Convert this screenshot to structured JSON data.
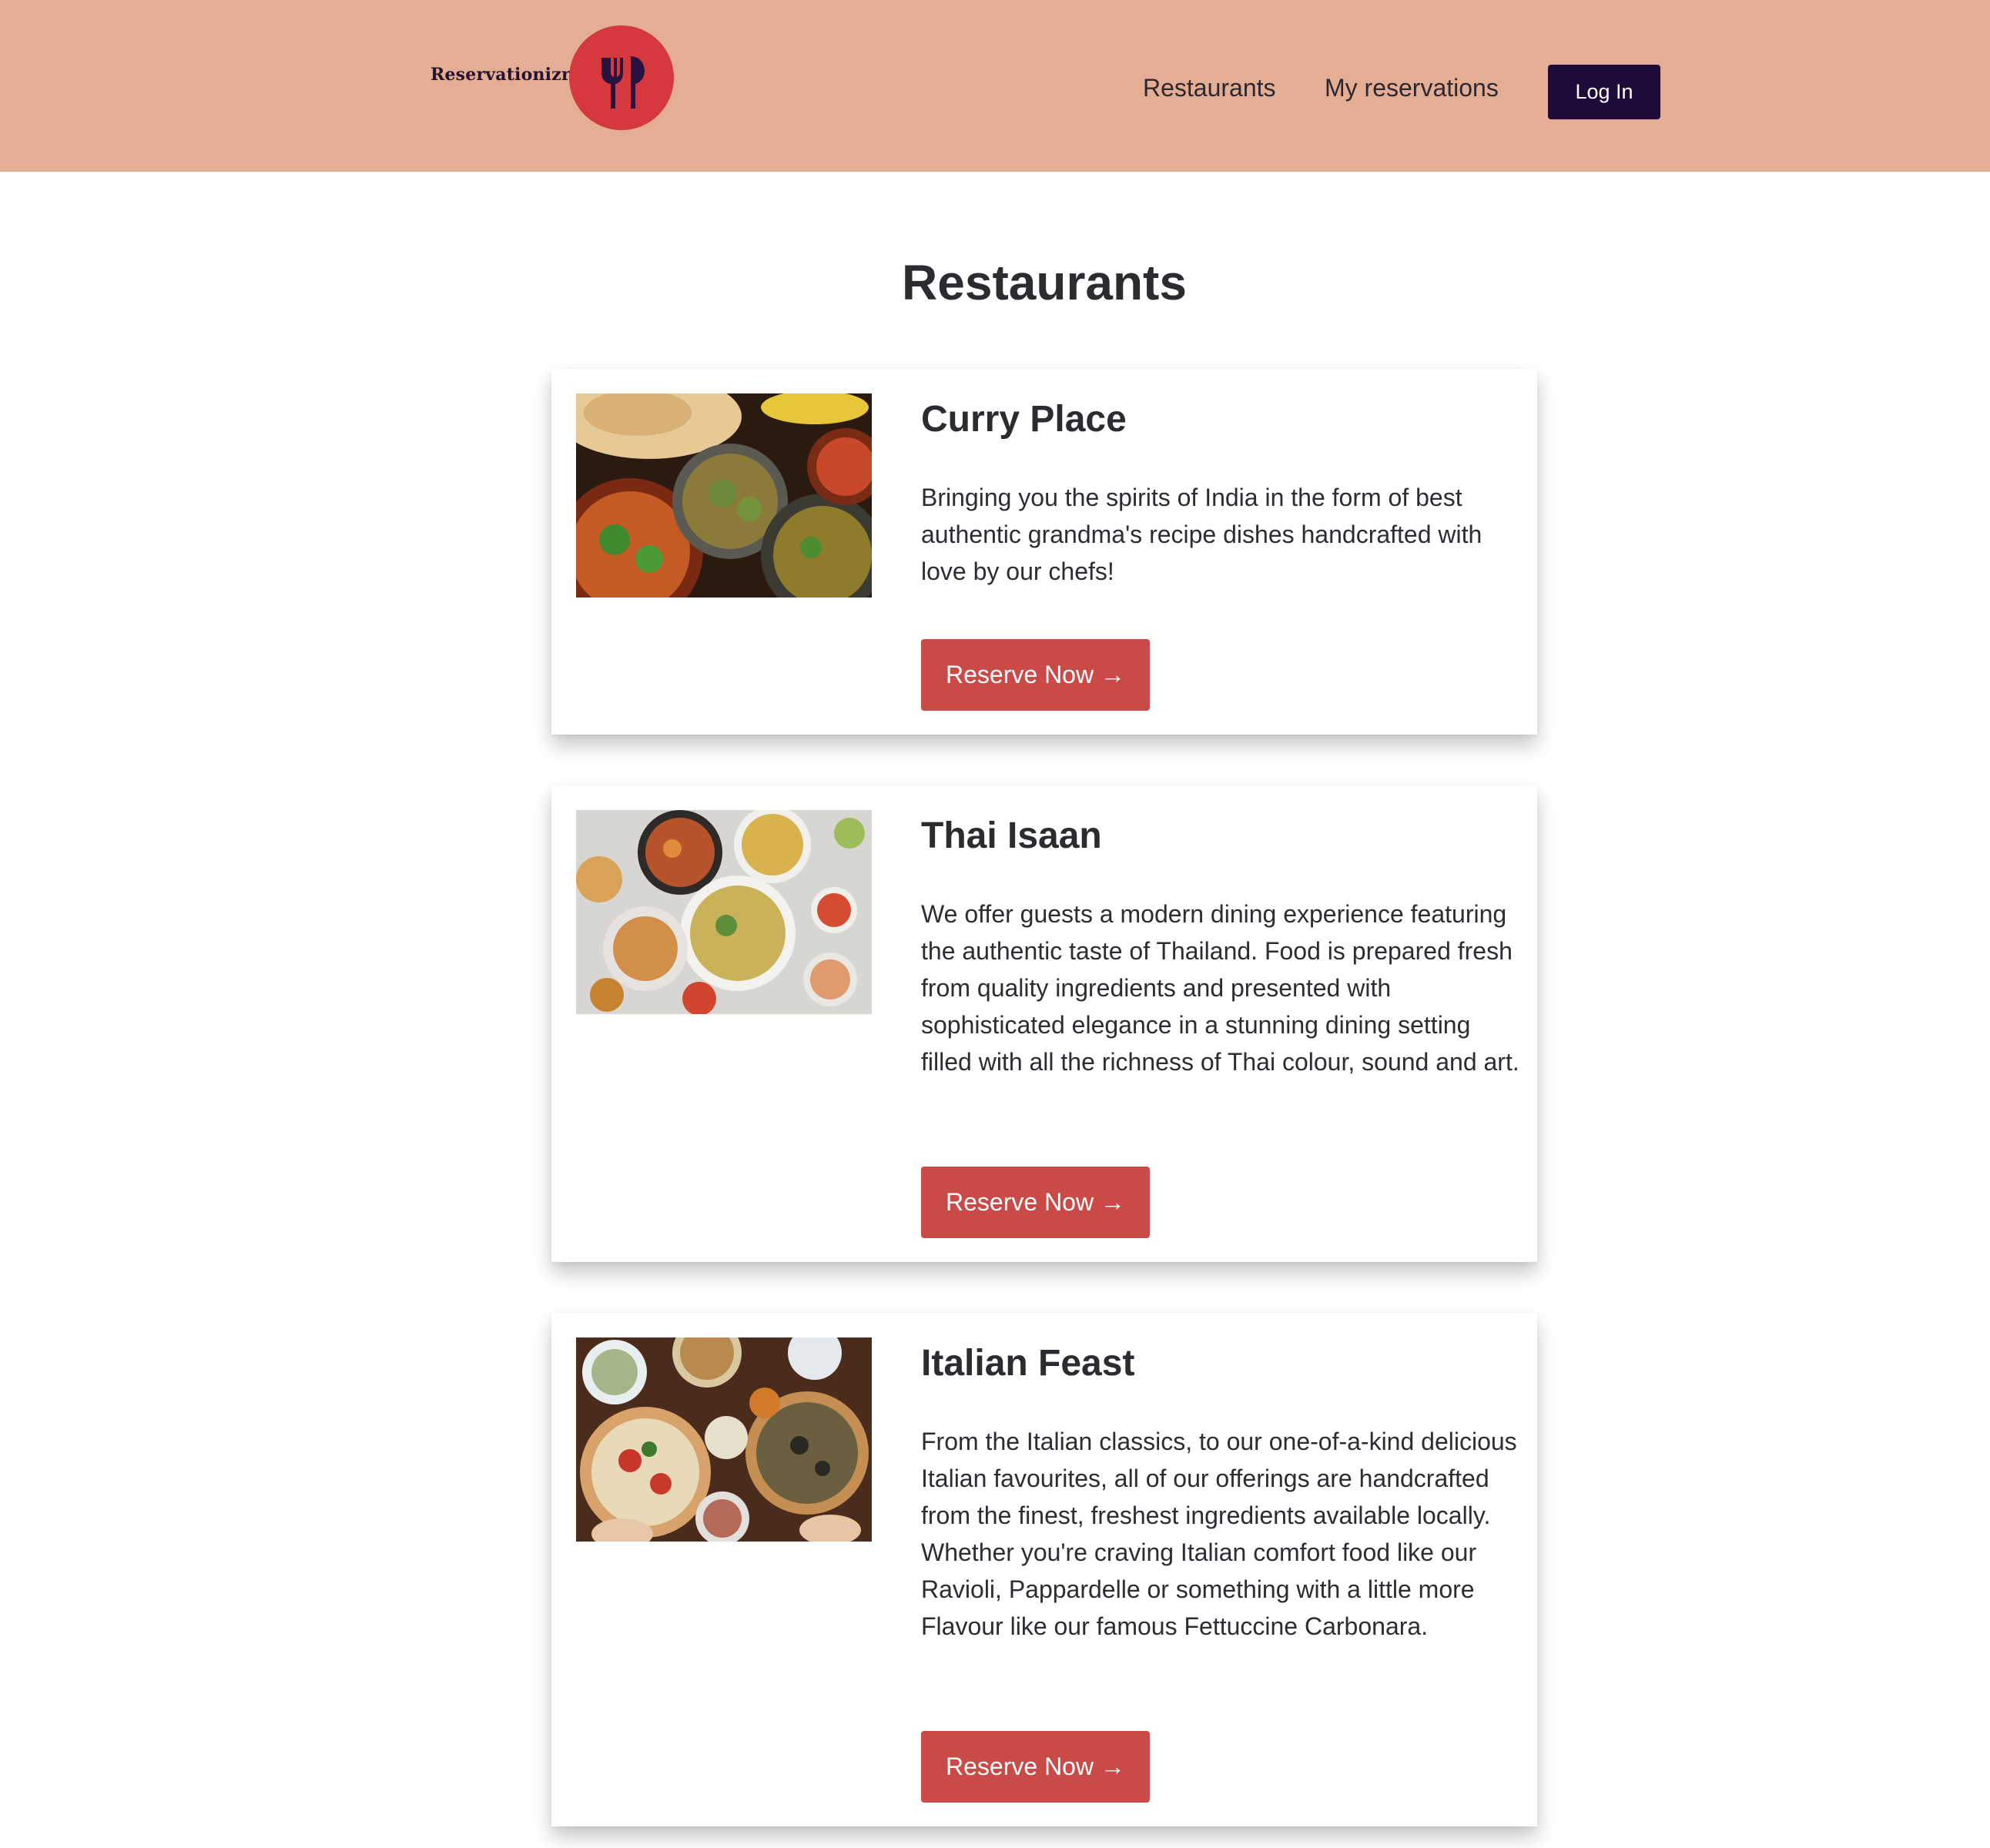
{
  "header": {
    "brand_name": "Reservationizr",
    "logo_icon": "fork-and-knife-icon",
    "nav": {
      "restaurants_label": "Restaurants",
      "reservations_label": "My reservations"
    },
    "login_label": "Log In"
  },
  "main": {
    "title": "Restaurants",
    "restaurants": [
      {
        "name": "Curry Place",
        "description": "Bringing you the spirits of India in the form of best authentic grandma's recipe dishes handcrafted with love by our chefs!",
        "button_label": "Reserve Now →"
      },
      {
        "name": "Thai Isaan",
        "description": "We offer guests a modern dining experience featuring the authentic taste of Thailand. Food is prepared fresh from quality ingredients and presented with sophisticated elegance in a stunning dining setting filled with all the richness of Thai colour, sound and art.",
        "button_label": "Reserve Now →"
      },
      {
        "name": "Italian Feast",
        "description": "From the Italian classics, to our one-of-a-kind delicious Italian favourites, all of our offerings are handcrafted from the finest, freshest ingredients available locally. Whether you're craving Italian comfort food like our Ravioli, Pappardelle or something with a little more Flavour like our famous Fettuccine Carbonara.",
        "button_label": "Reserve Now →"
      }
    ]
  },
  "colors": {
    "header_bg": "#e3ae93",
    "logo_bg": "#d5393d",
    "login_bg": "#1e0b3a",
    "reserve_bg": "#c94a46"
  }
}
